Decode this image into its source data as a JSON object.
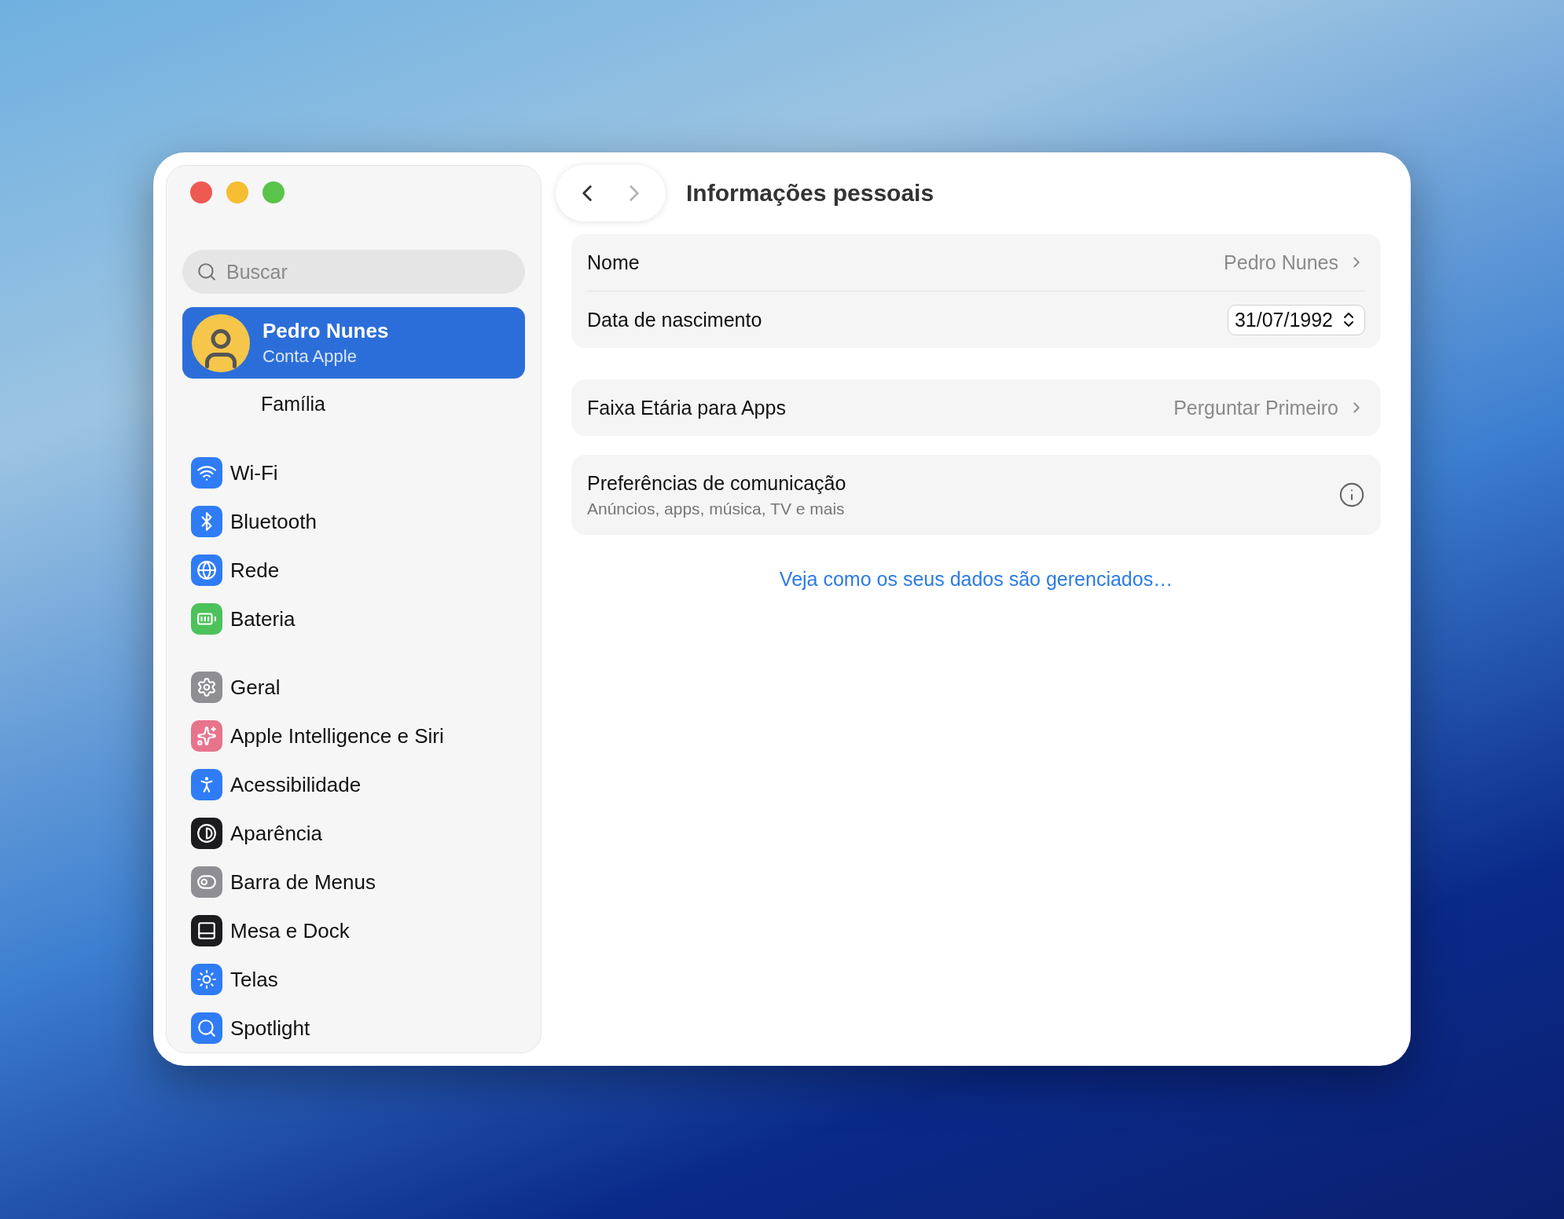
{
  "window": {
    "title": "Informações pessoais"
  },
  "navigation": {
    "back": {
      "disabled": false
    },
    "forward": {
      "disabled": true
    }
  },
  "sidebar": {
    "search": {
      "placeholder": "Buscar"
    },
    "account": {
      "name": "Pedro Nunes",
      "subtitle": "Conta Apple",
      "selected": true
    },
    "family": {
      "label": "Família",
      "selected": false
    },
    "groups": [
      {
        "items": [
          {
            "label": "Wi-Fi",
            "color": "#2f7cf6"
          },
          {
            "label": "Bluetooth",
            "color": "#2f7cf6"
          },
          {
            "label": "Rede",
            "color": "#2f7cf6"
          },
          {
            "label": "Bateria",
            "color": "#4cc25a"
          }
        ]
      },
      {
        "items": [
          {
            "label": "Geral",
            "color": "#8e8e93"
          },
          {
            "label": "Apple Intelligence e Siri",
            "color": "#e8748c"
          },
          {
            "label": "Acessibilidade",
            "color": "#2f7cf6"
          },
          {
            "label": "Aparência",
            "color": "#1c1c1e"
          },
          {
            "label": "Barra de Menus",
            "color": "#8e8e93"
          },
          {
            "label": "Mesa e Dock",
            "color": "#1c1c1e"
          },
          {
            "label": "Telas",
            "color": "#2f7cf6"
          },
          {
            "label": "Spotlight",
            "color": "#2f7cf6"
          }
        ]
      }
    ]
  },
  "sections": [
    {
      "rows": [
        {
          "kind": "link",
          "label": "Nome",
          "value": "Pedro Nunes"
        },
        {
          "kind": "date",
          "label": "Data de nascimento",
          "value": "31/07/1992"
        }
      ]
    },
    {
      "rows": [
        {
          "kind": "link",
          "label": "Faixa Etária para Apps",
          "value": "Perguntar Primeiro"
        }
      ]
    },
    {
      "rows": [
        {
          "kind": "info",
          "label": "Preferências de comunicação",
          "subtitle": "Anúncios, apps, música, TV e mais"
        }
      ]
    }
  ],
  "link": "Veja como os seus dados são gerenciados…"
}
